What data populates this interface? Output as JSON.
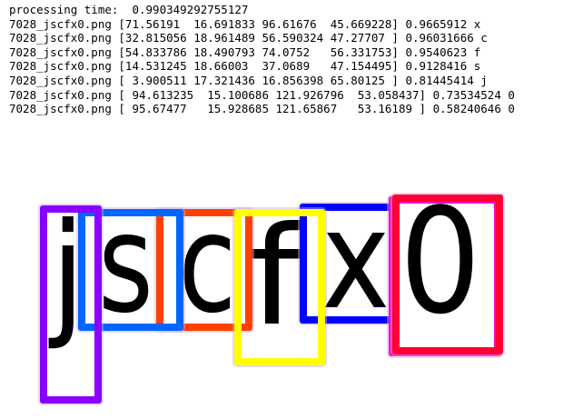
{
  "console": {
    "processing_line": "processing time:  0.990349292755127",
    "lines": [
      "7028_jscfx0.png [71.56191  16.691833 96.61676  45.669228] 0.9665912 x",
      "7028_jscfx0.png [32.815056 18.961489 56.590324 47.27707 ] 0.96031666 c",
      "7028_jscfx0.png [54.833786 18.490793 74.0752   56.331753] 0.9540623 f",
      "7028_jscfx0.png [14.531245 18.66003  37.0689   47.154495] 0.9128416 s",
      "7028_jscfx0.png [ 3.900511 17.321436 16.856398 65.80125 ] 0.81445414 j",
      "7028_jscfx0.png [ 94.613235  15.100686 121.926796  53.058437] 0.73534524 0",
      "7028_jscfx0.png [ 95.67477   15.928685 121.65867   53.16189 ] 0.58240646 0"
    ]
  },
  "image": {
    "glyphs": [
      "j",
      "s",
      "c",
      "f",
      "x",
      "0"
    ],
    "box_colors": {
      "j": "#8a00ff",
      "s": "#0066ff",
      "c": "#ff4000",
      "f": "#ffff00",
      "x": "#0000ff",
      "0_a": "#ff0033",
      "0_b": "#ff00cc"
    }
  }
}
